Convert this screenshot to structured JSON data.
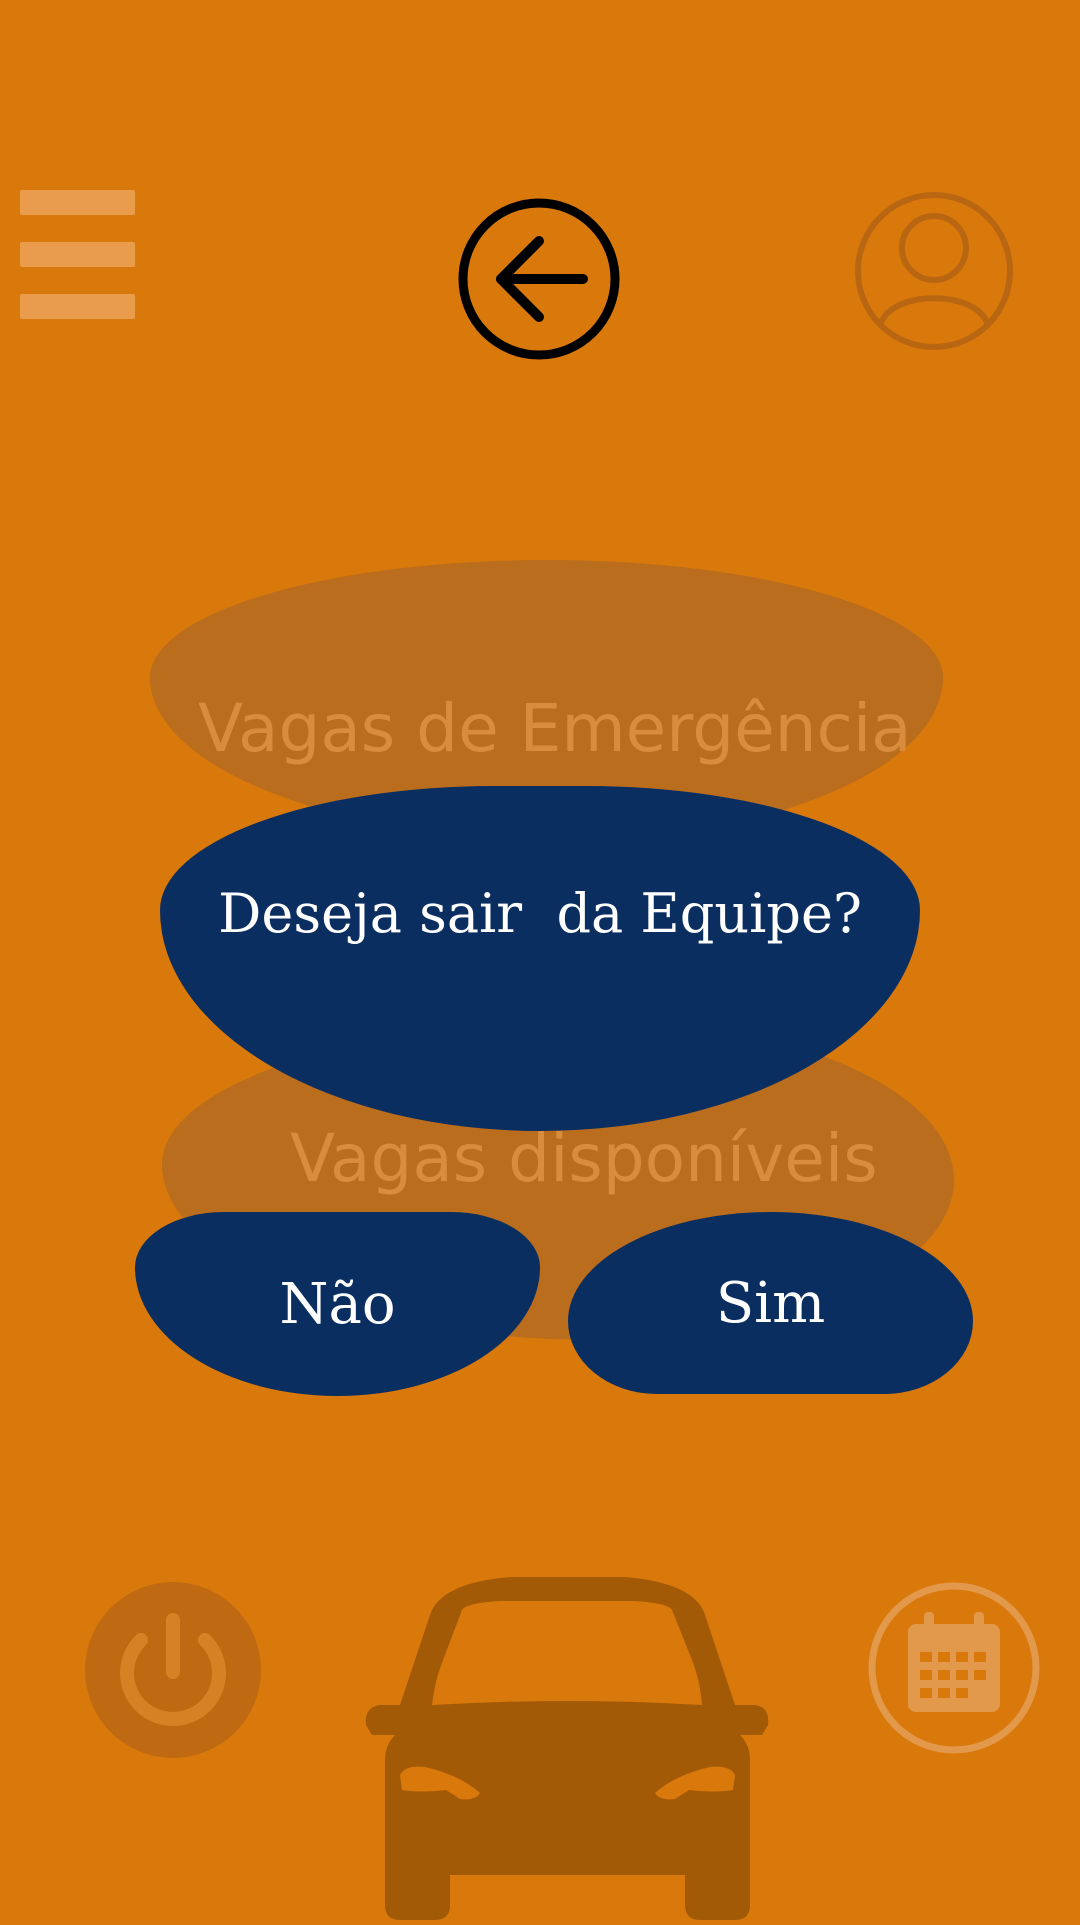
{
  "header": {
    "menu_icon": "menu-icon",
    "back_icon": "arrow-left-circle-icon",
    "profile_icon": "user-circle-icon"
  },
  "background_buttons": {
    "emergency_label": "Vagas de Emergência",
    "available_label": "Vagas disponíveis"
  },
  "dialog": {
    "message": "Deseja sair  da Equipe?",
    "no_label": "Não",
    "yes_label": "Sim"
  },
  "footer": {
    "power_icon": "power-icon",
    "car_icon": "car-icon",
    "calendar_icon": "calendar-icon"
  },
  "colors": {
    "background": "#d9780b",
    "dialog": "#0a2e60",
    "faded_button": "#b96d1d"
  }
}
